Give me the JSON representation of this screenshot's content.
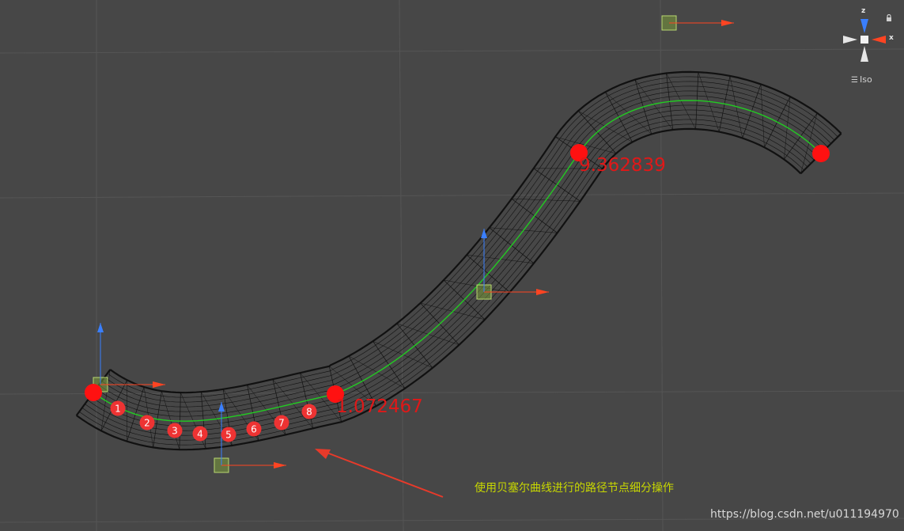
{
  "labels": {
    "mid_value": "9.362839",
    "low_value": "1.072467"
  },
  "annotation": {
    "text": "使用贝塞尔曲线进行的路径节点细分操作"
  },
  "watermark": {
    "text": "https://blog.csdn.net/u011194970"
  },
  "nodes": {
    "numbers": [
      "1",
      "2",
      "3",
      "4",
      "5",
      "6",
      "7",
      "8"
    ]
  },
  "gizmo": {
    "z_label": "z",
    "x_label": "x",
    "projection_label": "Iso",
    "projection_icon": "hamburger-icon"
  },
  "colors": {
    "background": "#474747",
    "grid": "#555555",
    "mesh": "#111111",
    "curve": "#22cc22",
    "control_point": "#ff1111",
    "node_marker": "#ee3333",
    "value_label": "#e01818",
    "annotation": "#c8d800",
    "axis_y": "#3a7fff",
    "axis_x": "#ff4422",
    "handle_box": "#7a9a3a"
  },
  "icons": {
    "lock": "lock-icon"
  }
}
